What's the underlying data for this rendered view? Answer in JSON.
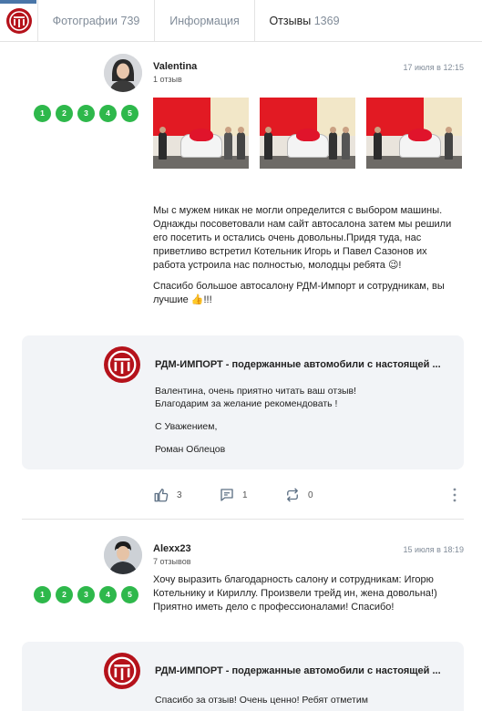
{
  "tabs": {
    "photos_label": "Фотографии",
    "photos_count": "739",
    "info_label": "Информация",
    "reviews_label": "Отзывы",
    "reviews_count": "1369"
  },
  "reviews": [
    {
      "author": "Valentina",
      "sub": "1 отзыв",
      "date": "17 июля в 12:15",
      "rating": [
        "1",
        "2",
        "3",
        "4",
        "5"
      ],
      "text_1": "Мы с мужем никак не могли определится с выбором машины. Однажды посоветовали нам сайт автосалона затем мы решили его посетить и остались очень довольны.Придя туда, нас приветливо встретил Котельник Игорь и Павел Сазонов их работа устроила нас полностью, молодцы ребята 😉!",
      "text_2": "Спасибо большое автосалону РДМ-Импорт и сотрудникам, вы лучшие 👍!!!",
      "reply": {
        "name": "РДМ-ИМПОРТ - подержанные автомобили с настоящей ...",
        "line_1": "Валентина, очень приятно читать ваш отзыв!",
        "line_2": "Благодарим за желание рекомендовать !",
        "line_3": "С Уважением,",
        "line_4": "Роман Облецов"
      },
      "actions": {
        "likes": "3",
        "comments": "1",
        "reposts": "0"
      }
    },
    {
      "author": "Alexx23",
      "sub": "7 отзывов",
      "date": "15 июля в 18:19",
      "rating": [
        "1",
        "2",
        "3",
        "4",
        "5"
      ],
      "text_1": "Хочу выразить благодарность салону и сотрудникам: Игорю Котельнику и Кириллу. Произвели трейд ин, жена довольна!) Приятно иметь дело с профессионалами! Спасибо!",
      "reply": {
        "name": "РДМ-ИМПОРТ - подержанные автомобили с настоящей ...",
        "line_1": "Спасибо за отзыв! Очень ценно! Ребят отметим"
      }
    }
  ],
  "icons": [
    "rdm-logo-icon",
    "like-icon",
    "comment-icon",
    "repost-icon",
    "more-icon",
    "avatar-woman-icon",
    "avatar-man-icon"
  ],
  "colors": {
    "brand_red": "#b5121b",
    "rating_green": "#2eb84b",
    "accent_blue": "#4a76a8",
    "reply_bg": "#f2f4f7"
  }
}
